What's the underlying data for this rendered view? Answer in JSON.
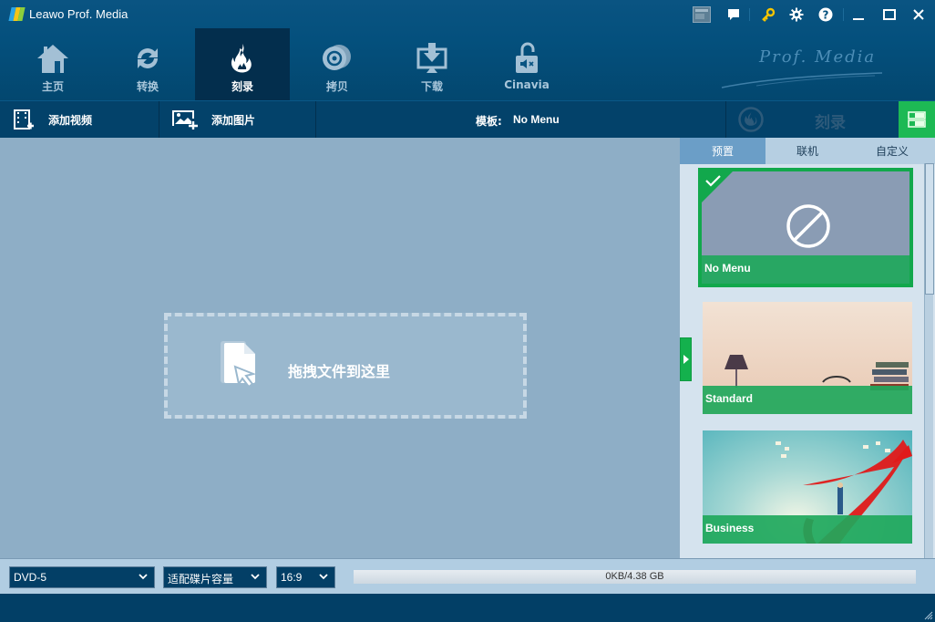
{
  "app": {
    "title": "Leawo Prof. Media",
    "brand_text": "Prof. Media"
  },
  "window_controls": {
    "icons": [
      "register-icon",
      "feedback-icon",
      "key-icon",
      "settings-icon",
      "help-icon",
      "minimize-icon",
      "maximize-icon",
      "close-icon"
    ]
  },
  "nav": {
    "items": [
      {
        "label": "主页",
        "icon": "home-icon",
        "active": false
      },
      {
        "label": "转换",
        "icon": "convert-icon",
        "active": false
      },
      {
        "label": "刻录",
        "icon": "burn-flame-icon",
        "active": true
      },
      {
        "label": "拷贝",
        "icon": "copy-disc-icon",
        "active": false
      },
      {
        "label": "下载",
        "icon": "download-icon",
        "active": false
      },
      {
        "label": "Cinavia",
        "icon": "cinavia-unlock-icon",
        "active": false
      }
    ]
  },
  "toolbar": {
    "add_video": "添加视频",
    "add_photo": "添加图片",
    "template_label": "模板:",
    "template_value": "No Menu",
    "burn_label": "刻录"
  },
  "main": {
    "drop_text": "拖拽文件到这里"
  },
  "side": {
    "tabs": [
      {
        "label": "预置",
        "active": true
      },
      {
        "label": "联机",
        "active": false
      },
      {
        "label": "自定义",
        "active": false
      }
    ],
    "templates": [
      {
        "name": "No Menu",
        "selected": true
      },
      {
        "name": "Standard",
        "selected": false
      },
      {
        "name": "Business",
        "selected": false
      }
    ]
  },
  "bottom": {
    "disc_type": "DVD-5",
    "quality": "适配碟片容量",
    "aspect": "16:9",
    "capacity_text": "0KB/4.38 GB",
    "capacity_used_fraction": 0
  },
  "colors": {
    "accent_green": "#1db954",
    "header_blue": "#04507d",
    "active_nav": "#032e4d"
  }
}
